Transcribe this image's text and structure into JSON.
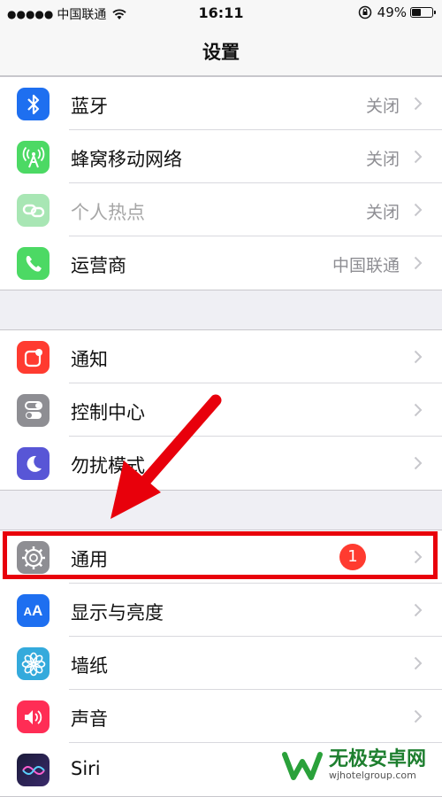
{
  "status_bar": {
    "signal_dots": "●●●●●",
    "carrier": "中国联通",
    "time": "16:11",
    "battery_text": "49%",
    "battery_level": 0.49
  },
  "nav": {
    "title": "设置"
  },
  "groups": [
    {
      "items": [
        {
          "label": "蓝牙",
          "value": "关闭",
          "icon": "bluetooth-icon",
          "color": "#1e6ff0"
        },
        {
          "label": "蜂窝移动网络",
          "value": "关闭",
          "icon": "cellular-antenna-icon",
          "color": "#4cd964"
        },
        {
          "label": "个人热点",
          "value": "关闭",
          "icon": "hotspot-link-icon",
          "color": "#a8e6b4",
          "dim": true
        },
        {
          "label": "运营商",
          "value": "中国联通",
          "icon": "phone-icon",
          "color": "#4cd964"
        }
      ]
    },
    {
      "items": [
        {
          "label": "通知",
          "icon": "notification-icon",
          "color": "#ff3b30"
        },
        {
          "label": "控制中心",
          "icon": "toggle-switches-icon",
          "color": "#8e8e93"
        },
        {
          "label": "勿扰模式",
          "icon": "moon-icon",
          "color": "#5856d6"
        }
      ]
    },
    {
      "items": [
        {
          "label": "通用",
          "badge": "1",
          "icon": "gear-icon",
          "color": "#8e8e93"
        },
        {
          "label": "显示与亮度",
          "icon": "text-size-icon",
          "color": "#1e6ff0"
        },
        {
          "label": "墙纸",
          "icon": "flower-icon",
          "color": "#34aadc"
        },
        {
          "label": "声音",
          "icon": "speaker-icon",
          "color": "#ff2d55"
        },
        {
          "label": "Siri",
          "icon": "siri-icon",
          "color": "#222244"
        }
      ]
    }
  ],
  "watermark": {
    "title": "无极安卓网",
    "url": "wjhotelgroup.com"
  }
}
